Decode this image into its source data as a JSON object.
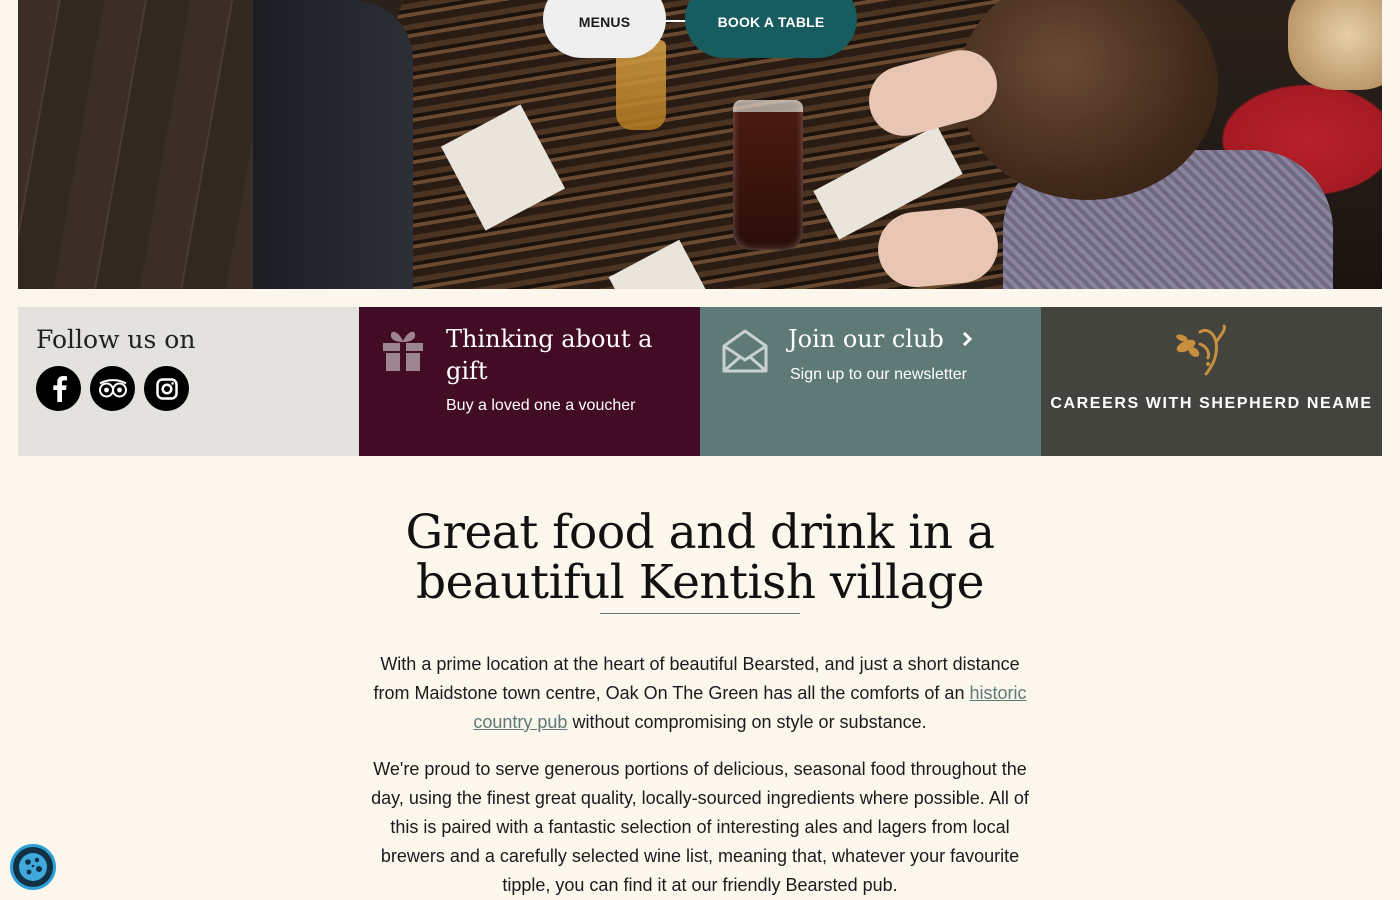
{
  "hero": {
    "menus_label": "MENUS",
    "book_label": "BOOK A TABLE"
  },
  "panels": {
    "follow": {
      "title": "Follow us on",
      "icons": [
        "facebook-icon",
        "tripadvisor-icon",
        "instagram-icon"
      ]
    },
    "gift": {
      "title": "Thinking about a gift",
      "subtitle": "Buy a loved one a voucher",
      "icon": "gift-icon"
    },
    "club": {
      "title": "Join our club",
      "subtitle": "Sign up to our newsletter",
      "icon": "envelope-icon"
    },
    "careers": {
      "label": "CAREERS WITH SHEPHERD NEAME",
      "icon": "hop-icon"
    }
  },
  "intro": {
    "heading": "Great food and drink in a beautiful Kentish village",
    "p1_before": "With a prime location at the heart of beautiful Bearsted, and just a short distance from Maidstone town centre, Oak On The Green has all the comforts of an",
    "p1_link": "historic country pub",
    "p1_after": "without compromising on style or substance.",
    "p2": "We're proud to serve generous portions of delicious, seasonal food throughout the day, using the finest great quality, locally-sourced ingredients where possible. All of this is paired with a fantastic selection of interesting ales and lagers from local brewers and a carefully selected wine list, meaning that, whatever your favourite tipple, you can find it at our friendly Bearsted pub."
  },
  "colors": {
    "page_bg": "#fbf7ed",
    "book_btn": "#175c5e",
    "gift_panel": "#430c25",
    "club_panel": "#5f7a76",
    "careers_panel": "#44443f",
    "follow_panel": "#e4e2df",
    "hop_gold": "#c8903e"
  },
  "cookie": {
    "icon": "cookie-icon"
  }
}
